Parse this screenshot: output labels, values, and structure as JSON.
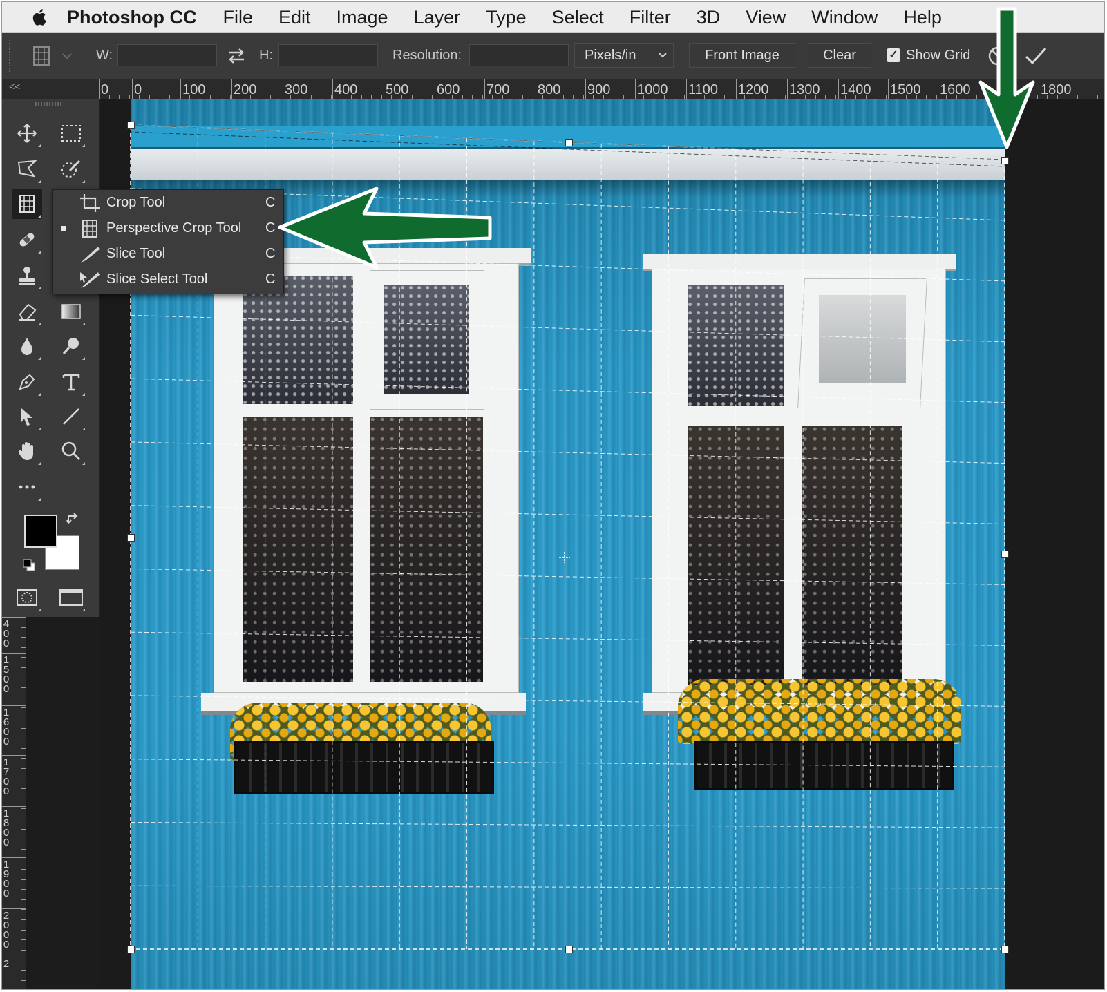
{
  "menubar": {
    "app": "Photoshop CC",
    "items": [
      "File",
      "Edit",
      "Image",
      "Layer",
      "Type",
      "Select",
      "Filter",
      "3D",
      "View",
      "Window",
      "Help"
    ]
  },
  "options": {
    "w_label": "W:",
    "h_label": "H:",
    "resolution_label": "Resolution:",
    "units": "Pixels/in",
    "front_image": "Front Image",
    "clear": "Clear",
    "show_grid": "Show Grid",
    "show_grid_checked": true
  },
  "ruler": {
    "collapse": "<<",
    "h_labels": [
      "0",
      "0",
      "100",
      "200",
      "300",
      "400",
      "500",
      "600",
      "700",
      "800",
      "900",
      "1000",
      "1100",
      "1200",
      "1300",
      "1400",
      "1500",
      "1600",
      "1800"
    ],
    "v_labels": [
      "400",
      "1500",
      "1600",
      "1700",
      "1800",
      "1900",
      "2000",
      "2"
    ]
  },
  "flyout": {
    "items": [
      {
        "label": "Crop Tool",
        "key": "C",
        "icon": "crop-icon",
        "active": false
      },
      {
        "label": "Perspective Crop Tool",
        "key": "C",
        "icon": "perspective-crop-icon",
        "active": true
      },
      {
        "label": "Slice Tool",
        "key": "C",
        "icon": "slice-icon",
        "active": false
      },
      {
        "label": "Slice Select Tool",
        "key": "C",
        "icon": "slice-select-icon",
        "active": false
      }
    ]
  },
  "colors": {
    "annotation_arrow": "#0f6b2e",
    "siding": "#2b9fcf",
    "foreground": "#000000",
    "background": "#ffffff"
  }
}
